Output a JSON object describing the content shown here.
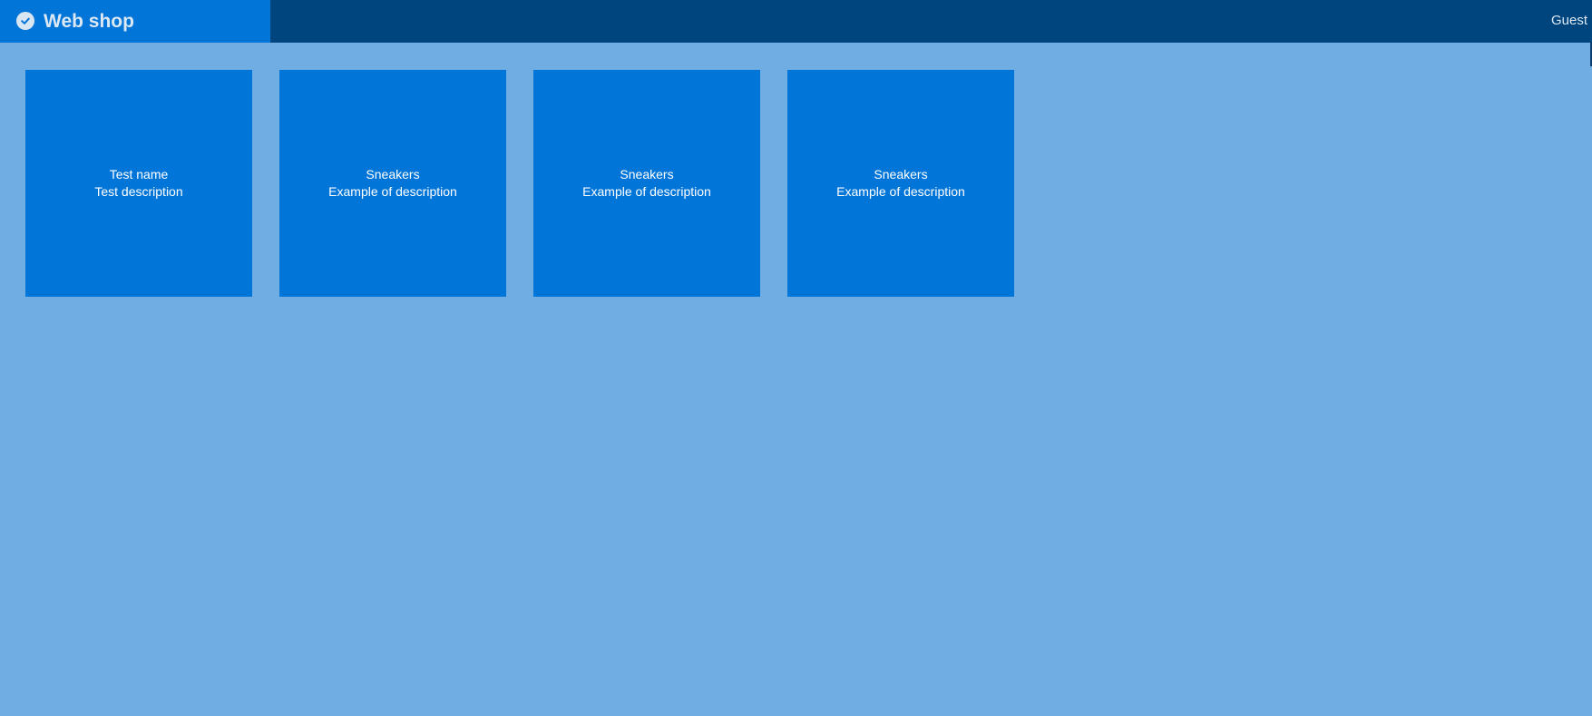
{
  "header": {
    "title": "Web shop",
    "icon": "check-circle-icon",
    "user": "Guest"
  },
  "products": [
    {
      "name": "Test name",
      "description": "Test description"
    },
    {
      "name": "Sneakers",
      "description": "Example of description"
    },
    {
      "name": "Sneakers",
      "description": "Example of description"
    },
    {
      "name": "Sneakers",
      "description": "Example of description"
    }
  ],
  "colors": {
    "background": "#70ade3",
    "topbar": "#00457e",
    "brand": "#0175d8",
    "card": "#0175d8"
  }
}
